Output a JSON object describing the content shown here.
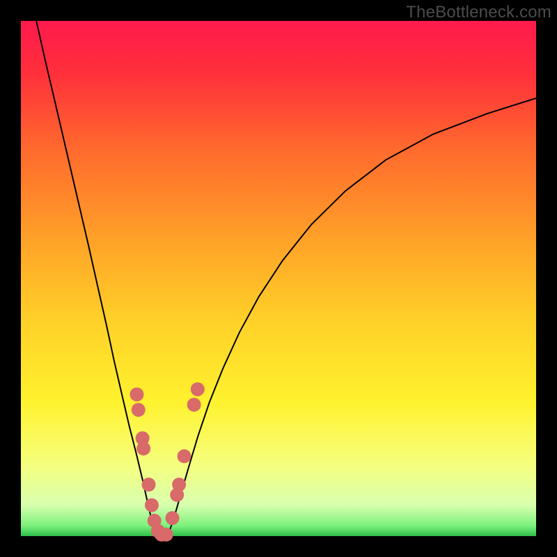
{
  "watermark": "TheBottleneck.com",
  "chart_data": {
    "type": "line",
    "title": "",
    "xlabel": "",
    "ylabel": "",
    "xlim": [
      0,
      100
    ],
    "ylim": [
      0,
      100
    ],
    "grid": false,
    "legend": false,
    "gradient_stops": [
      {
        "offset": 0,
        "color": "#ff1a4d"
      },
      {
        "offset": 0.1,
        "color": "#ff2f3b"
      },
      {
        "offset": 0.25,
        "color": "#ff6a2d"
      },
      {
        "offset": 0.42,
        "color": "#ffa028"
      },
      {
        "offset": 0.58,
        "color": "#ffd028"
      },
      {
        "offset": 0.74,
        "color": "#fff22e"
      },
      {
        "offset": 0.86,
        "color": "#f6ff7d"
      },
      {
        "offset": 0.94,
        "color": "#d8ffaf"
      },
      {
        "offset": 0.98,
        "color": "#7cf17c"
      },
      {
        "offset": 1.0,
        "color": "#2dbf4a"
      }
    ],
    "series": [
      {
        "name": "left-curve",
        "color": "#000000",
        "x": [
          3.0,
          4.8,
          6.8,
          8.9,
          11.0,
          13.1,
          14.9,
          16.6,
          18.1,
          19.6,
          21.0,
          22.4,
          23.6,
          24.6,
          25.4,
          26.2
        ],
        "y": [
          100.0,
          92.0,
          83.5,
          74.5,
          65.5,
          56.5,
          48.5,
          41.0,
          34.0,
          27.5,
          21.5,
          16.0,
          11.0,
          6.5,
          3.0,
          0.3
        ]
      },
      {
        "name": "valley-floor",
        "color": "#000000",
        "x": [
          26.2,
          26.6,
          27.0,
          27.4,
          27.8,
          28.2,
          28.6
        ],
        "y": [
          0.3,
          0.1,
          0.0,
          0.0,
          0.0,
          0.1,
          0.3
        ]
      },
      {
        "name": "right-curve",
        "color": "#000000",
        "x": [
          28.6,
          29.7,
          31.0,
          32.6,
          34.4,
          36.6,
          39.2,
          42.4,
          46.2,
          50.8,
          56.4,
          63.0,
          70.8,
          80.0,
          90.5,
          100.0
        ],
        "y": [
          0.3,
          3.5,
          8.0,
          13.5,
          19.5,
          26.0,
          32.5,
          39.5,
          46.5,
          53.5,
          60.5,
          67.0,
          73.0,
          78.0,
          82.0,
          85.0
        ]
      },
      {
        "name": "beads-left",
        "type": "scatter",
        "color": "#d96a6a",
        "x": [
          22.5,
          22.8,
          23.6,
          23.8,
          24.8,
          25.4,
          25.9,
          26.6,
          27.3
        ],
        "y": [
          27.5,
          24.5,
          19.0,
          17.0,
          10.0,
          6.0,
          3.0,
          1.0,
          0.3
        ]
      },
      {
        "name": "beads-right",
        "type": "scatter",
        "color": "#d96a6a",
        "x": [
          28.2,
          29.4,
          30.3,
          30.7,
          31.7,
          33.6,
          34.3
        ],
        "y": [
          0.3,
          3.5,
          8.0,
          10.0,
          15.5,
          25.5,
          28.5
        ]
      }
    ]
  }
}
